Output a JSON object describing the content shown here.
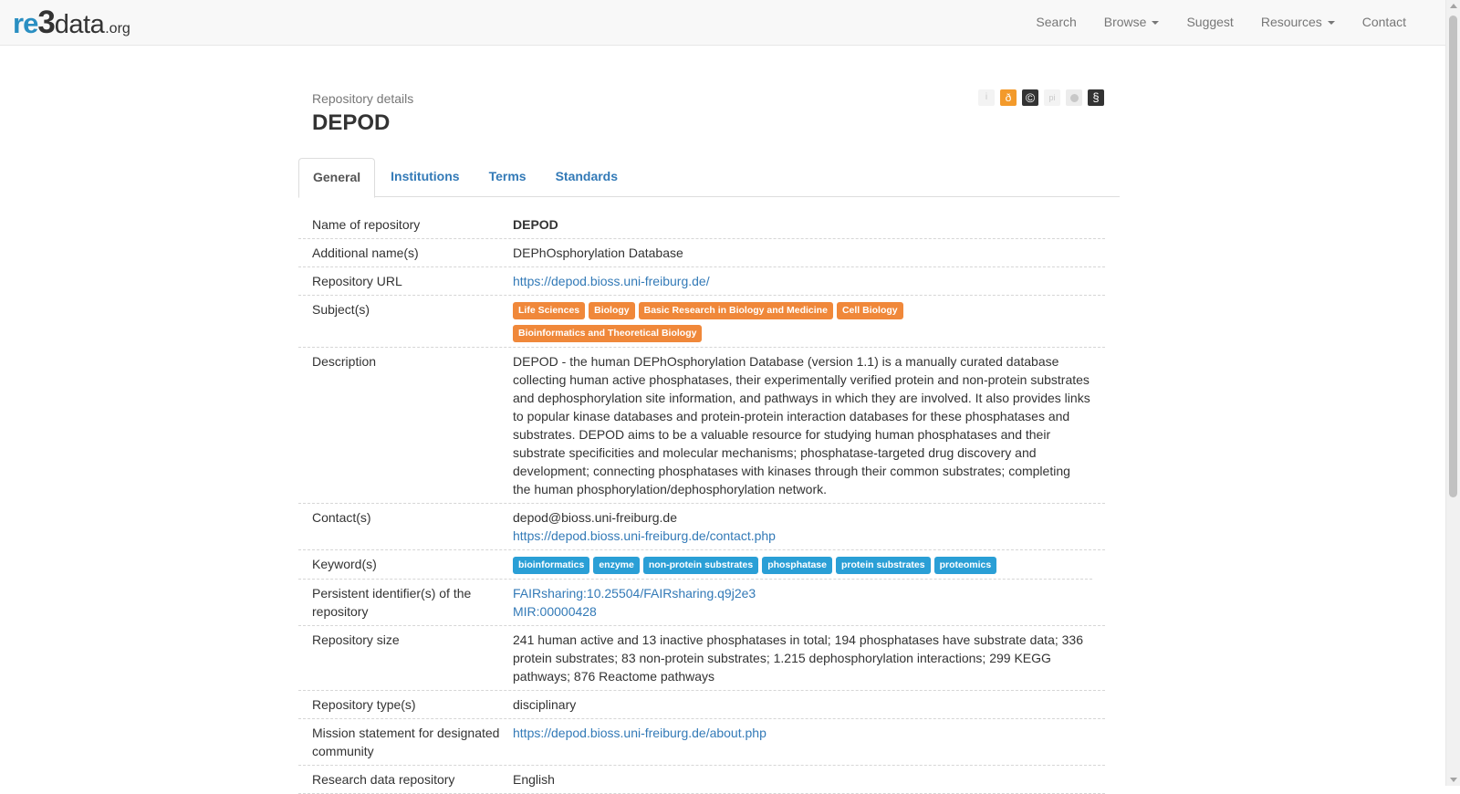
{
  "brand": {
    "re": "re",
    "three": "3",
    "data": "data",
    "org": ".org"
  },
  "nav": {
    "search": "Search",
    "browse": "Browse",
    "suggest": "Suggest",
    "resources": "Resources",
    "contact": "Contact"
  },
  "header": {
    "overline": "Repository details",
    "title": "DEPOD"
  },
  "icons": [
    {
      "name": "info-icon",
      "glyph": "i"
    },
    {
      "name": "open-access-icon",
      "glyph": "ð",
      "color": "#f39a2b"
    },
    {
      "name": "copyright-icon",
      "glyph": "©",
      "color": "#333333"
    },
    {
      "name": "pid-icon",
      "glyph": "pi"
    },
    {
      "name": "certificate-icon",
      "glyph": ""
    },
    {
      "name": "policy-icon",
      "glyph": "§",
      "color": "#333333"
    }
  ],
  "tabs": [
    "General",
    "Institutions",
    "Terms",
    "Standards"
  ],
  "details": {
    "name": {
      "label": "Name of repository",
      "value": "DEPOD"
    },
    "additional": {
      "label": "Additional name(s)",
      "value": "DEPhOsphorylation Database"
    },
    "url": {
      "label": "Repository URL",
      "value": "https://depod.bioss.uni-freiburg.de/"
    },
    "subjects": {
      "label": "Subject(s)",
      "tags": [
        "Life Sciences",
        "Biology",
        "Basic Research in Biology and Medicine",
        "Cell Biology",
        "Bioinformatics and Theoretical Biology"
      ]
    },
    "description": {
      "label": "Description",
      "value": "DEPOD - the human DEPhOsphorylation Database (version 1.1) is a manually curated database collecting human active phosphatases, their experimentally verified protein and non-protein substrates and dephosphorylation site information, and pathways in which they are involved. It also provides links to popular kinase databases and protein-protein interaction databases for these phosphatases and substrates. DEPOD aims to be a valuable resource for studying human phosphatases and their substrate specificities and molecular mechanisms; phosphatase-targeted drug discovery and development; connecting phosphatases with kinases through their common substrates; completing the human phosphorylation/dephosphorylation network."
    },
    "contacts": {
      "label": "Contact(s)",
      "email": "depod@bioss.uni-freiburg.de",
      "link": "https://depod.bioss.uni-freiburg.de/contact.php"
    },
    "keywords": {
      "label": "Keyword(s)",
      "tags": [
        "bioinformatics",
        "enzyme",
        "non-protein substrates",
        "phosphatase",
        "protein substrates",
        "proteomics"
      ]
    },
    "pids": {
      "label": "Persistent identifier(s) of the repository",
      "values": [
        "FAIRsharing:10.25504/FAIRsharing.q9j2e3",
        "MIR:00000428"
      ]
    },
    "size": {
      "label": "Repository size",
      "value": "241 human active and 13 inactive phosphatases in total; 194 phosphatases have substrate data; 336 protein substrates; 83 non-protein substrates; 1.215 dephosphorylation interactions; 299 KEGG pathways; 876 Reactome pathways"
    },
    "types": {
      "label": "Repository type(s)",
      "value": "disciplinary"
    },
    "mission": {
      "label": "Mission statement for designated community",
      "value": "https://depod.bioss.uni-freiburg.de/about.php"
    },
    "language": {
      "label": "Research data repository",
      "value": "English"
    }
  }
}
